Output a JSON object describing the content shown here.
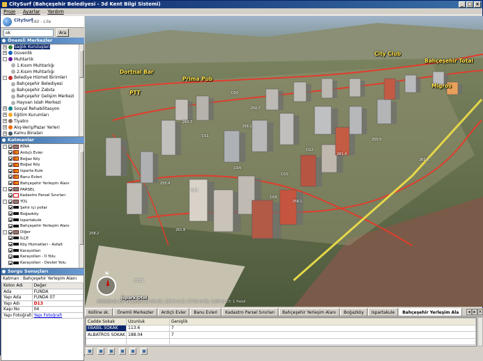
{
  "window": {
    "title": "CitySurf (Bahçeşehir Belediyesi - 3d Kent Bilgi Sistemi)"
  },
  "menu": [
    "Proje",
    "Ayarlar",
    "Yardım"
  ],
  "brand": {
    "name": "CitySurf",
    "version": "160 - Lite"
  },
  "search": {
    "value": "ok",
    "button": "Ara"
  },
  "panels": {
    "poi": "Önemli Merkezler",
    "layers": "Katmanlar",
    "results": "Sorgu Sonuçları"
  },
  "poi_tree": [
    {
      "label": "Sağlık Kuruluşları",
      "level": 0,
      "exp": "+",
      "icon": "#2e7d32",
      "selected": true
    },
    {
      "label": "Güvenlik",
      "level": 0,
      "exp": "+",
      "icon": "#1565c0"
    },
    {
      "label": "Muhtarlık",
      "level": 0,
      "exp": "-",
      "icon": "#6a1b9a"
    },
    {
      "label": "1.Kısım Muhtarlığı",
      "level": 2,
      "exp": "",
      "icon": "#b0b0b0"
    },
    {
      "label": "2.Kısım Muhtarlığı",
      "level": 2,
      "exp": "",
      "icon": "#b0b0b0"
    },
    {
      "label": "Belediye Hizmet Birimleri",
      "level": 0,
      "exp": "-",
      "icon": "#c62828"
    },
    {
      "label": "Bahçeşehir Belediyesi",
      "level": 2,
      "exp": "",
      "icon": "#b0b0b0"
    },
    {
      "label": "Bahçeşehir Zabıta",
      "level": 2,
      "exp": "",
      "icon": "#b0b0b0"
    },
    {
      "label": "Bahçeşehir Gelişim Merkezi",
      "level": 2,
      "exp": "",
      "icon": "#b0b0b0"
    },
    {
      "label": "Hayvan Islah Merkezi",
      "level": 2,
      "exp": "",
      "icon": "#b0b0b0"
    },
    {
      "label": "Sosyal Rehabilitasyon",
      "level": 0,
      "exp": "+",
      "icon": "#00838f"
    },
    {
      "label": "Eğitim Kurumları",
      "level": 0,
      "exp": "+",
      "icon": "#f9a825"
    },
    {
      "label": "Tiyatro",
      "level": 0,
      "exp": "+",
      "icon": "#8d6e63"
    },
    {
      "label": "Alış-Veriş/Pazar Yerleri",
      "level": 0,
      "exp": "+",
      "icon": "#ef6c00"
    },
    {
      "label": "Kamu Binaları",
      "level": 0,
      "exp": "+",
      "icon": "#455a64"
    }
  ],
  "layer_tree": [
    {
      "label": "BİNA",
      "level": 0,
      "type": "group"
    },
    {
      "label": "Ardıçlı Evler",
      "level": 1,
      "type": "bld"
    },
    {
      "label": "Boğaz Köy",
      "level": 1,
      "type": "bld"
    },
    {
      "label": "Boğaz Köy",
      "level": 1,
      "type": "bld"
    },
    {
      "label": "Isparta Kule",
      "level": 1,
      "type": "bld"
    },
    {
      "label": "Banu Evleri",
      "level": 1,
      "type": "bld"
    },
    {
      "label": "Bahçeşehir Yerleşim Alanı",
      "level": 1,
      "type": "bld"
    },
    {
      "label": "PARSEL",
      "level": 0,
      "type": "group"
    },
    {
      "label": "Kadastro Parsel Sınırları",
      "level": 1,
      "type": "par"
    },
    {
      "label": "YOL",
      "level": 0,
      "type": "group"
    },
    {
      "label": "Şehir içi yollar",
      "level": 1,
      "type": "line"
    },
    {
      "label": "Boğazköy",
      "level": 1,
      "type": "line"
    },
    {
      "label": "Ispartakule",
      "level": 1,
      "type": "line"
    },
    {
      "label": "Bahçeşehir Yerleşim Alanı",
      "level": 1,
      "type": "line"
    },
    {
      "label": "Diğer",
      "level": 0,
      "type": "group"
    },
    {
      "label": "İLÇE",
      "level": 1,
      "type": "line"
    },
    {
      "label": "Köy Hizmetleri - Asfalt",
      "level": 1,
      "type": "line"
    },
    {
      "label": "Karayolları",
      "level": 1,
      "type": "line"
    },
    {
      "label": "Karayolları - İl Yolu",
      "level": 1,
      "type": "line"
    },
    {
      "label": "Karayolları - Devlet Yolu",
      "level": 1,
      "type": "line"
    }
  ],
  "results": {
    "layer_label": "Katman : Bahçeşehir Yerleşim Alanı",
    "header": [
      "Kolon Adı",
      "Değer"
    ],
    "rows": [
      {
        "k": "Ada",
        "v": "FUNDA",
        "style": ""
      },
      {
        "k": "Yapı Ada",
        "v": "FUNDA 07",
        "style": ""
      },
      {
        "k": "Yapı Adı",
        "v": "D13",
        "style": "red"
      },
      {
        "k": "Kapı No",
        "v": "04",
        "style": ""
      },
      {
        "k": "Yapı Fotoğrafı",
        "v": "Yapı Fotoğrafı",
        "style": "link"
      }
    ]
  },
  "map_labels": {
    "dortnal": "Dortnal Bar",
    "prima": "Prima Pub",
    "ptt": "PTT",
    "cityclub": "City Club",
    "total": "Bahçeşehir Total",
    "migros": "Migros",
    "ispark": "İspark Otol"
  },
  "height_marks": [
    "261.4",
    "256.1",
    "260.7",
    "261.6",
    "255.4",
    "250.7",
    "261.8",
    "253.9",
    "258.2",
    "250.5",
    "258.1"
  ],
  "building_marks": [
    "D13",
    "D16",
    "D15",
    "D14",
    "D12",
    "D11",
    "D10"
  ],
  "statusbar": "388838.91 EW  4538585.13 NS   Alt: 127.9 m  Z: 17.00 m  DL: 0.00 m  Cf: 1 Palet",
  "bottom_tabs": [
    "Kolline sk.",
    "Önemli Merkezler",
    "Ardıçlı Evler",
    "Banu Evleri",
    "Kadastro Parsel Sınırları",
    "Bahçeşehir Yerleşim Alanı",
    "Boğazköy",
    "Ispartakule",
    "Bahçeşehir Yerleşim Ala"
  ],
  "bottom_grid": {
    "header": [
      "Cadde Sokak",
      "Uzunluk",
      "Genişlik"
    ],
    "rows": [
      [
        "EBABİL SOKAK",
        "113.6",
        "7"
      ],
      [
        "ALBATROS SOKAK",
        "188.04",
        "7"
      ],
      [
        "",
        "",
        ""
      ]
    ]
  },
  "colors": {
    "accent": "#0a246a",
    "roads": "#e23c2c",
    "labels": "#ffe14a"
  }
}
